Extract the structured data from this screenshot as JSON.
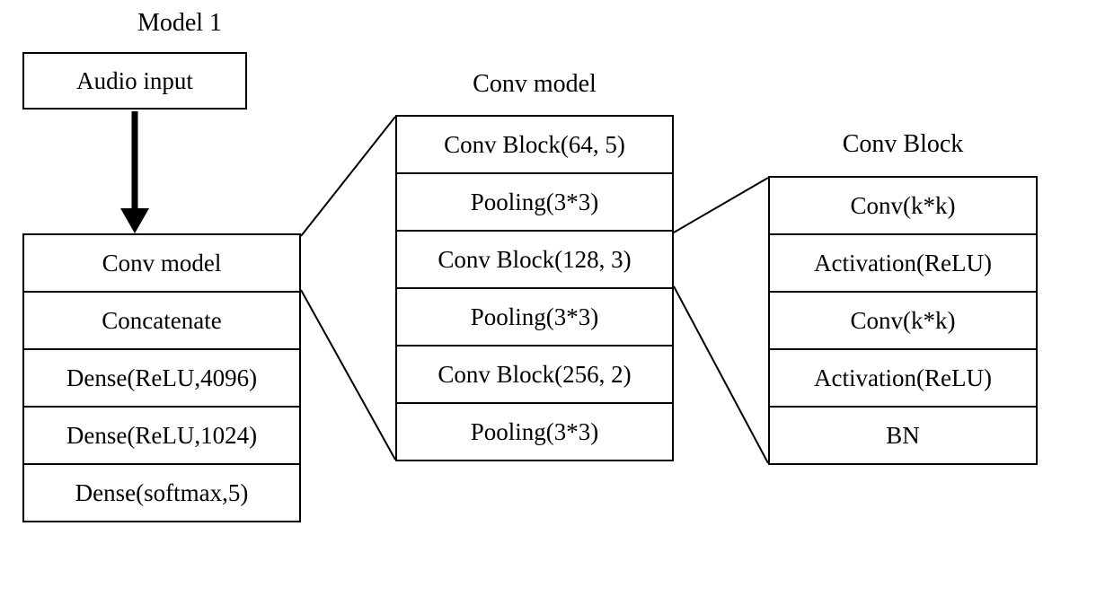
{
  "titles": {
    "model1": "Model 1",
    "conv_model": "Conv  model",
    "conv_block": "Conv  Block"
  },
  "audio_input": "Audio input",
  "model1_layers": [
    "Conv model",
    "Concatenate",
    "Dense(ReLU,4096)",
    "Dense(ReLU,1024)",
    "Dense(softmax,5)"
  ],
  "conv_model_layers": [
    "Conv Block(64, 5)",
    "Pooling(3*3)",
    "Conv Block(128, 3)",
    "Pooling(3*3)",
    "Conv Block(256, 2)",
    "Pooling(3*3)"
  ],
  "conv_block_layers": [
    "Conv(k*k)",
    "Activation(ReLU)",
    "Conv(k*k)",
    "Activation(ReLU)",
    "BN"
  ]
}
